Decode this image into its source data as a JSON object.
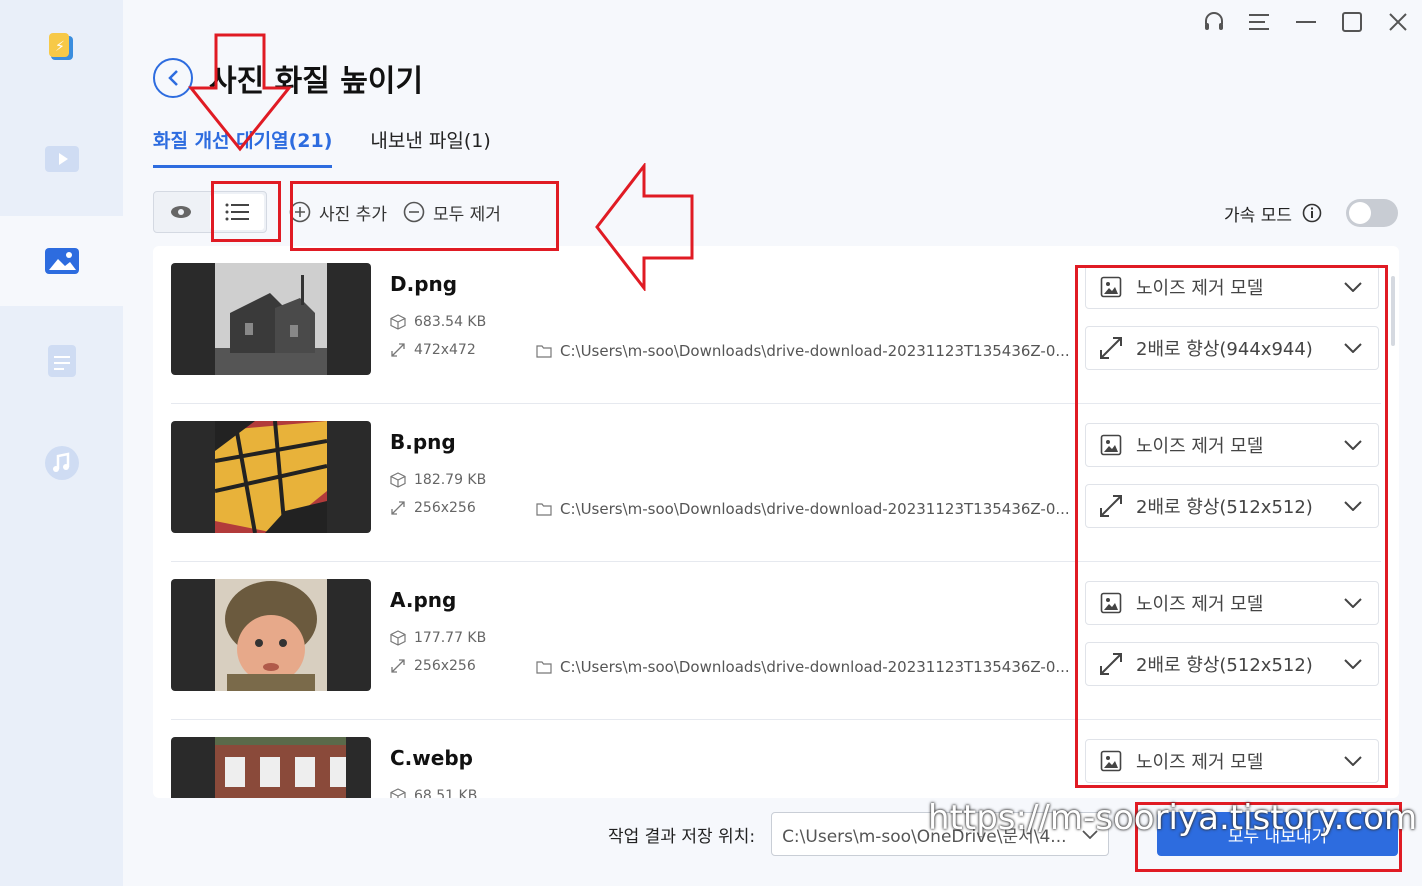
{
  "header": {
    "title": "사진 화질 높이기"
  },
  "tabs": [
    {
      "label": "화질 개선 대기열(21)",
      "active": true
    },
    {
      "label": "내보낸 파일(1)",
      "active": false
    }
  ],
  "toolbar": {
    "add_label": "사진 추가",
    "remove_all_label": "모두 제거",
    "accel_label": "가속 모드"
  },
  "rows": [
    {
      "name": "D.png",
      "size": "683.54 KB",
      "dims": "472x472",
      "path": "C:\\Users\\m-soo\\Downloads\\drive-download-20231123T135436Z-0...",
      "model": "노이즈 제거 모델",
      "scale": "2배로 향상(944x944)"
    },
    {
      "name": "B.png",
      "size": "182.79 KB",
      "dims": "256x256",
      "path": "C:\\Users\\m-soo\\Downloads\\drive-download-20231123T135436Z-0...",
      "model": "노이즈 제거 모델",
      "scale": "2배로 향상(512x512)"
    },
    {
      "name": "A.png",
      "size": "177.77 KB",
      "dims": "256x256",
      "path": "C:\\Users\\m-soo\\Downloads\\drive-download-20231123T135436Z-0...",
      "model": "노이즈 제거 모델",
      "scale": "2배로 향상(512x512)"
    },
    {
      "name": "C.webp",
      "size": "68.51 KB",
      "dims": "",
      "path": "",
      "model": "노이즈 제거 모델",
      "scale": ""
    }
  ],
  "footer": {
    "save_label": "작업 결과 저장 위치:",
    "save_path": "C:\\Users\\m-soo\\OneDrive\\문서\\4...",
    "export_label": "모두 내보내기"
  },
  "watermark": "https://m-sooriya.tistory.com",
  "colors": {
    "accent": "#2d6cdf",
    "annotation": "#e01b24"
  }
}
